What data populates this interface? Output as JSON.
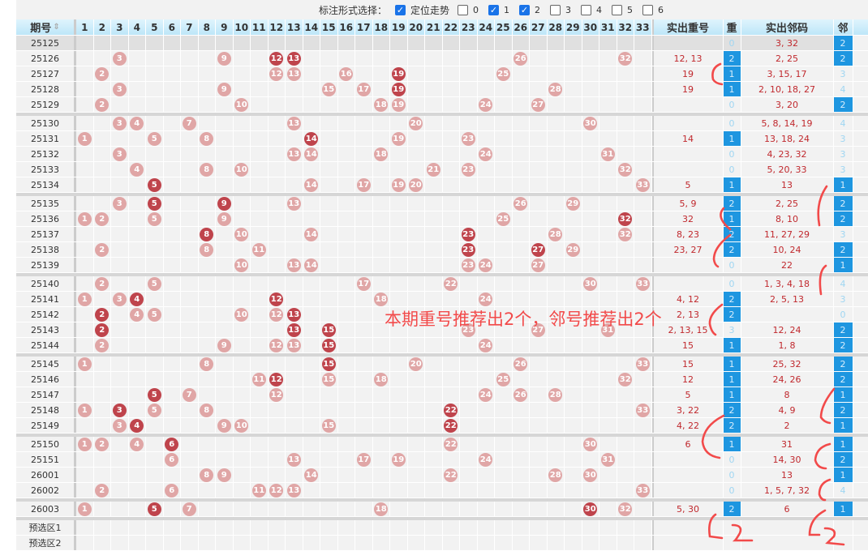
{
  "toolbar": {
    "label": "标注形式选择：",
    "trend_label": "定位走势",
    "trend_checked": true,
    "options": [
      {
        "label": "0",
        "checked": false
      },
      {
        "label": "1",
        "checked": true
      },
      {
        "label": "2",
        "checked": true
      },
      {
        "label": "3",
        "checked": false
      },
      {
        "label": "4",
        "checked": false
      },
      {
        "label": "5",
        "checked": false
      },
      {
        "label": "6",
        "checked": false
      }
    ]
  },
  "header": {
    "period": "期号",
    "numbers": [
      1,
      2,
      3,
      4,
      5,
      6,
      7,
      8,
      9,
      10,
      11,
      12,
      13,
      14,
      15,
      16,
      17,
      18,
      19,
      20,
      21,
      22,
      23,
      24,
      25,
      26,
      27,
      28,
      29,
      30,
      31,
      32,
      33
    ],
    "repeat_numbers": "实出重号",
    "repeat_count": "重",
    "neighbor_numbers": "实出邻码",
    "neighbor_count": "邻"
  },
  "colors": {
    "ball": "#e0a6a6",
    "ball_repeat": "#bf444c",
    "highlight": "#1e96e0",
    "annotation": "#f24a4a"
  },
  "groups": [
    [
      {
        "period": "25125",
        "balls": [],
        "repeat": [],
        "rep_text": "",
        "rep_count": 0,
        "nb_text": "3, 32",
        "nb_count": 2
      },
      {
        "period": "25126",
        "balls": [
          3,
          9,
          12,
          13,
          26,
          32
        ],
        "repeat": [
          12,
          13
        ],
        "rep_text": "12, 13",
        "rep_count": 2,
        "nb_text": "2, 25",
        "nb_count": 2
      },
      {
        "period": "25127",
        "balls": [
          2,
          12,
          13,
          16,
          19,
          25
        ],
        "repeat": [
          19
        ],
        "rep_text": "19",
        "rep_count": 1,
        "nb_text": "3, 15, 17",
        "nb_count": 3
      },
      {
        "period": "25128",
        "balls": [
          3,
          9,
          15,
          17,
          19,
          28
        ],
        "repeat": [
          19
        ],
        "rep_text": "19",
        "rep_count": 1,
        "nb_text": "2, 10, 18, 27",
        "nb_count": 4
      },
      {
        "period": "25129",
        "balls": [
          2,
          10,
          18,
          19,
          24,
          27
        ],
        "repeat": [],
        "rep_text": "",
        "rep_count": 0,
        "nb_text": "3, 20",
        "nb_count": 2
      }
    ],
    [
      {
        "period": "25130",
        "balls": [
          3,
          4,
          7,
          13,
          20,
          30
        ],
        "repeat": [],
        "rep_text": "",
        "rep_count": 0,
        "nb_text": "5, 8, 14, 19",
        "nb_count": 4
      },
      {
        "period": "25131",
        "balls": [
          1,
          5,
          8,
          14,
          19,
          23
        ],
        "repeat": [
          14
        ],
        "rep_text": "14",
        "rep_count": 1,
        "nb_text": "13, 18, 24",
        "nb_count": 3
      },
      {
        "period": "25132",
        "balls": [
          3,
          13,
          14,
          18,
          24,
          31
        ],
        "repeat": [],
        "rep_text": "",
        "rep_count": 0,
        "nb_text": "4, 23, 32",
        "nb_count": 3
      },
      {
        "period": "25133",
        "balls": [
          4,
          8,
          10,
          21,
          23,
          32
        ],
        "repeat": [],
        "rep_text": "",
        "rep_count": 0,
        "nb_text": "5, 20, 33",
        "nb_count": 3
      },
      {
        "period": "25134",
        "balls": [
          5,
          14,
          17,
          19,
          20,
          33
        ],
        "repeat": [
          5
        ],
        "rep_text": "5",
        "rep_count": 1,
        "nb_text": "13",
        "nb_count": 1
      }
    ],
    [
      {
        "period": "25135",
        "balls": [
          3,
          5,
          9,
          13,
          26,
          29
        ],
        "repeat": [
          5,
          9
        ],
        "rep_text": "5, 9",
        "rep_count": 2,
        "nb_text": "2, 25",
        "nb_count": 2
      },
      {
        "period": "25136",
        "balls": [
          1,
          2,
          5,
          9,
          25,
          32
        ],
        "repeat": [
          32
        ],
        "rep_text": "32",
        "rep_count": 1,
        "nb_text": "8, 10",
        "nb_count": 2
      },
      {
        "period": "25137",
        "balls": [
          8,
          10,
          14,
          23,
          28,
          32
        ],
        "repeat": [
          8,
          23
        ],
        "rep_text": "8, 23",
        "rep_count": 2,
        "nb_text": "11, 27, 29",
        "nb_count": 3
      },
      {
        "period": "25138",
        "balls": [
          2,
          8,
          11,
          23,
          27,
          29
        ],
        "repeat": [
          23,
          27
        ],
        "rep_text": "23, 27",
        "rep_count": 2,
        "nb_text": "10, 24",
        "nb_count": 2
      },
      {
        "period": "25139",
        "balls": [
          10,
          13,
          14,
          23,
          24,
          27
        ],
        "repeat": [],
        "rep_text": "",
        "rep_count": 0,
        "nb_text": "22",
        "nb_count": 1
      }
    ],
    [
      {
        "period": "25140",
        "balls": [
          2,
          5,
          17,
          22,
          30,
          33
        ],
        "repeat": [],
        "rep_text": "",
        "rep_count": 0,
        "nb_text": "1, 3, 4, 18",
        "nb_count": 4
      },
      {
        "period": "25141",
        "balls": [
          1,
          3,
          4,
          12,
          18,
          24
        ],
        "repeat": [
          4,
          12
        ],
        "rep_text": "4, 12",
        "rep_count": 2,
        "nb_text": "2, 5, 13",
        "nb_count": 3
      },
      {
        "period": "25142",
        "balls": [
          2,
          4,
          5,
          10,
          12,
          13
        ],
        "repeat": [
          2,
          13
        ],
        "rep_text": "2, 13",
        "rep_count": 2,
        "nb_text": "",
        "nb_count": 0
      },
      {
        "period": "25143",
        "balls": [
          2,
          13,
          15,
          23,
          27,
          31
        ],
        "repeat": [
          2,
          13,
          15
        ],
        "rep_text": "2, 13, 15",
        "rep_count": 3,
        "nb_text": "12, 24",
        "nb_count": 2
      },
      {
        "period": "25144",
        "balls": [
          2,
          9,
          12,
          13,
          15,
          24
        ],
        "repeat": [
          15
        ],
        "rep_text": "15",
        "rep_count": 1,
        "nb_text": "1, 8",
        "nb_count": 2
      }
    ],
    [
      {
        "period": "25145",
        "balls": [
          1,
          8,
          15,
          20,
          26,
          33
        ],
        "repeat": [
          15
        ],
        "rep_text": "15",
        "rep_count": 1,
        "nb_text": "25, 32",
        "nb_count": 2
      },
      {
        "period": "25146",
        "balls": [
          11,
          12,
          15,
          18,
          25,
          32
        ],
        "repeat": [
          12
        ],
        "rep_text": "12",
        "rep_count": 1,
        "nb_text": "24, 26",
        "nb_count": 2
      },
      {
        "period": "25147",
        "balls": [
          5,
          7,
          12,
          24,
          26,
          28
        ],
        "repeat": [
          5
        ],
        "rep_text": "5",
        "rep_count": 1,
        "nb_text": "8",
        "nb_count": 1
      },
      {
        "period": "25148",
        "balls": [
          1,
          3,
          5,
          8,
          22,
          33
        ],
        "repeat": [
          3,
          22
        ],
        "rep_text": "3, 22",
        "rep_count": 2,
        "nb_text": "4, 9",
        "nb_count": 2
      },
      {
        "period": "25149",
        "balls": [
          3,
          4,
          9,
          10,
          15,
          22
        ],
        "repeat": [
          4,
          22
        ],
        "rep_text": "4, 22",
        "rep_count": 2,
        "nb_text": "2",
        "nb_count": 1
      }
    ],
    [
      {
        "period": "25150",
        "balls": [
          1,
          2,
          4,
          6,
          22,
          30
        ],
        "repeat": [
          6
        ],
        "rep_text": "6",
        "rep_count": 1,
        "nb_text": "31",
        "nb_count": 1
      },
      {
        "period": "25151",
        "balls": [
          6,
          13,
          17,
          19,
          24,
          31
        ],
        "repeat": [],
        "rep_text": "",
        "rep_count": 0,
        "nb_text": "14, 30",
        "nb_count": 2
      },
      {
        "period": "26001",
        "balls": [
          8,
          9,
          14,
          22,
          28,
          30
        ],
        "repeat": [],
        "rep_text": "",
        "rep_count": 0,
        "nb_text": "13",
        "nb_count": 1
      },
      {
        "period": "26002",
        "balls": [
          2,
          6,
          11,
          12,
          13,
          33
        ],
        "repeat": [],
        "rep_text": "",
        "rep_count": 0,
        "nb_text": "1, 5, 7, 32",
        "nb_count": 4
      }
    ],
    [
      {
        "period": "26003",
        "balls": [
          1,
          5,
          7,
          18,
          30,
          32
        ],
        "repeat": [
          5,
          30
        ],
        "rep_text": "5, 30",
        "rep_count": 2,
        "nb_text": "6",
        "nb_count": 1
      }
    ]
  ],
  "preselect": [
    "预选区1",
    "预选区2"
  ],
  "annotation": {
    "note": "本期重号推荐出2个，邻号推荐出2个",
    "handwritten": [
      "2",
      "2"
    ]
  }
}
